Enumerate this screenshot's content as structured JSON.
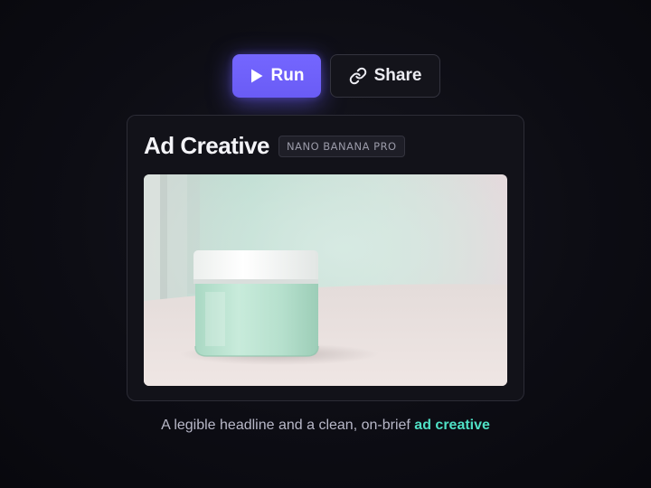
{
  "toolbar": {
    "run_label": "Run",
    "share_label": "Share",
    "run_icon": "play-icon",
    "share_icon": "link-icon"
  },
  "card": {
    "title": "Ad Creative",
    "badge": "NANO BANANA PRO",
    "image_subject": "frosted mint glass cosmetic jar with white lid"
  },
  "caption": {
    "text": "A legible headline and a clean, on-brief",
    "highlight": "ad creative"
  },
  "colors": {
    "accent": "#6a5cf5",
    "highlight": "#4fe0c5",
    "background": "#0d0d14"
  }
}
